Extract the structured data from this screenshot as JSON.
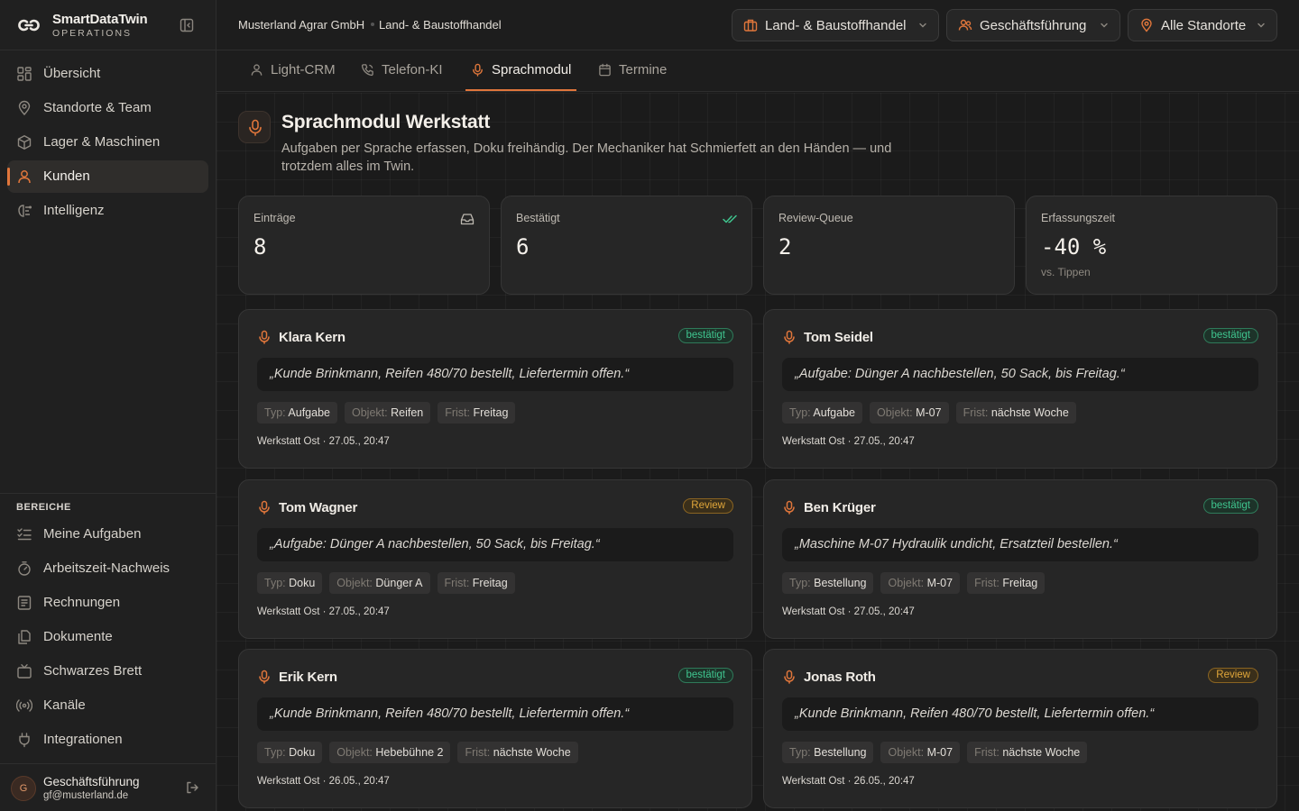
{
  "brand": {
    "name": "SmartDataTwin",
    "subtitle": "OPERATIONS"
  },
  "sidebar": {
    "nav": [
      {
        "label": "Übersicht",
        "icon": "grid-icon"
      },
      {
        "label": "Standorte & Team",
        "icon": "map-pin-icon"
      },
      {
        "label": "Lager & Maschinen",
        "icon": "box-icon"
      },
      {
        "label": "Kunden",
        "icon": "user-icon",
        "active": true
      },
      {
        "label": "Intelligenz",
        "icon": "brain-icon"
      }
    ],
    "section_title": "BEREICHE",
    "areas": [
      {
        "label": "Meine Aufgaben",
        "icon": "checklist-icon"
      },
      {
        "label": "Arbeitszeit-Nachweis",
        "icon": "timer-icon"
      },
      {
        "label": "Rechnungen",
        "icon": "invoice-icon"
      },
      {
        "label": "Dokumente",
        "icon": "document-icon"
      },
      {
        "label": "Schwarzes Brett",
        "icon": "board-icon"
      },
      {
        "label": "Kanäle",
        "icon": "radio-icon"
      },
      {
        "label": "Integrationen",
        "icon": "plug-icon"
      }
    ],
    "user": {
      "initial": "G",
      "name": "Geschäftsführung",
      "email": "gf@musterland.de"
    }
  },
  "header": {
    "breadcrumb": [
      "Musterland Agrar GmbH",
      "Land- & Baustoffhandel"
    ],
    "dropdowns": [
      {
        "label": "Land- & Baustoffhandel",
        "icon": "briefcase-icon"
      },
      {
        "label": "Geschäftsführung",
        "icon": "users-icon"
      },
      {
        "label": "Alle Standorte",
        "icon": "map-pin-icon"
      }
    ]
  },
  "tabs": [
    {
      "label": "Light-CRM",
      "icon": "user-icon"
    },
    {
      "label": "Telefon-KI",
      "icon": "phone-icon"
    },
    {
      "label": "Sprachmodul",
      "icon": "mic-icon",
      "active": true
    },
    {
      "label": "Termine",
      "icon": "calendar-icon"
    }
  ],
  "page": {
    "title": "Sprachmodul Werkstatt",
    "description": "Aufgaben per Sprache erfassen, Doku freihändig. Der Mechaniker hat Schmierfett an den Händen — und trotzdem alles im Twin."
  },
  "stats": [
    {
      "label": "Einträge",
      "value": "8",
      "icon": "inbox-icon"
    },
    {
      "label": "Bestätigt",
      "value": "6",
      "icon": "double-check-icon",
      "icon_color": "#3fc48e"
    },
    {
      "label": "Review-Queue",
      "value": "2"
    },
    {
      "label": "Erfassungszeit",
      "value": "-40 %",
      "sub": "vs. Tippen"
    }
  ],
  "labels": {
    "type": "Typ:",
    "object": "Objekt:",
    "deadline": "Frist:"
  },
  "entries": [
    {
      "name": "Klara Kern",
      "status": "bestätigt",
      "status_kind": "ok",
      "quote": "„Kunde Brinkmann, Reifen 480/70 bestellt, Liefertermin offen.“",
      "type": "Aufgabe",
      "object": "Reifen",
      "deadline": "Freitag",
      "meta": "Werkstatt Ost · 27.05., 20:47"
    },
    {
      "name": "Tom Seidel",
      "status": "bestätigt",
      "status_kind": "ok",
      "quote": "„Aufgabe: Dünger A nachbestellen, 50 Sack, bis Freitag.“",
      "type": "Aufgabe",
      "object": "M-07",
      "deadline": "nächste Woche",
      "meta": "Werkstatt Ost · 27.05., 20:47"
    },
    {
      "name": "Tom Wagner",
      "status": "Review",
      "status_kind": "rev",
      "quote": "„Aufgabe: Dünger A nachbestellen, 50 Sack, bis Freitag.“",
      "type": "Doku",
      "object": "Dünger A",
      "deadline": "Freitag",
      "meta": "Werkstatt Ost · 27.05., 20:47"
    },
    {
      "name": "Ben Krüger",
      "status": "bestätigt",
      "status_kind": "ok",
      "quote": "„Maschine M-07 Hydraulik undicht, Ersatzteil bestellen.“",
      "type": "Bestellung",
      "object": "M-07",
      "deadline": "Freitag",
      "meta": "Werkstatt Ost · 27.05., 20:47"
    },
    {
      "name": "Erik Kern",
      "status": "bestätigt",
      "status_kind": "ok",
      "quote": "„Kunde Brinkmann, Reifen 480/70 bestellt, Liefertermin offen.“",
      "type": "Doku",
      "object": "Hebebühne 2",
      "deadline": "nächste Woche",
      "meta": "Werkstatt Ost · 26.05., 20:47"
    },
    {
      "name": "Jonas Roth",
      "status": "Review",
      "status_kind": "rev",
      "quote": "„Kunde Brinkmann, Reifen 480/70 bestellt, Liefertermin offen.“",
      "type": "Bestellung",
      "object": "M-07",
      "deadline": "nächste Woche",
      "meta": "Werkstatt Ost · 26.05., 20:47"
    }
  ],
  "colors": {
    "accent": "#e0763b",
    "ok": "#3fc48e",
    "review": "#e0a63a",
    "background": "#1b1b1b",
    "card": "#262626"
  }
}
